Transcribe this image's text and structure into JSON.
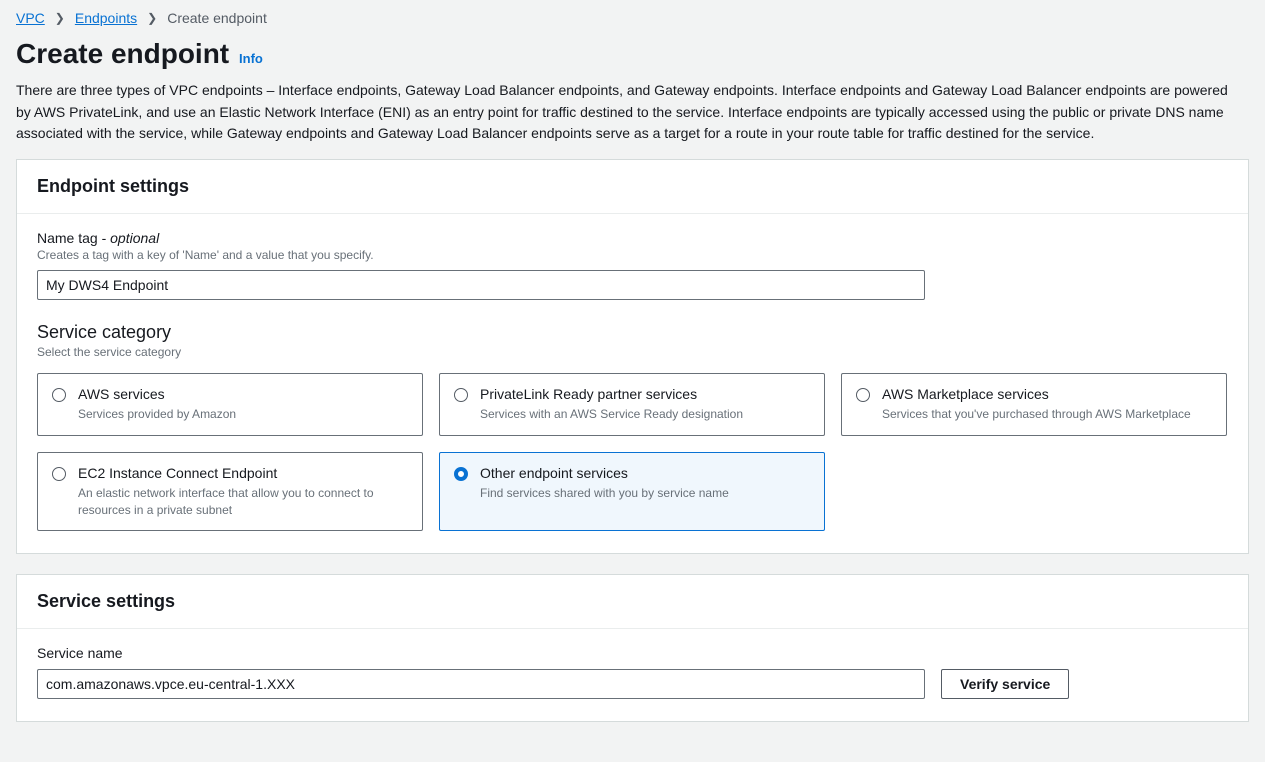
{
  "breadcrumb": {
    "items": [
      {
        "label": "VPC",
        "link": true
      },
      {
        "label": "Endpoints",
        "link": true
      },
      {
        "label": "Create endpoint",
        "link": false
      }
    ]
  },
  "page": {
    "title": "Create endpoint",
    "info_label": "Info",
    "intro": "There are three types of VPC endpoints – Interface endpoints, Gateway Load Balancer endpoints, and Gateway endpoints. Interface endpoints and Gateway Load Balancer endpoints are powered by AWS PrivateLink, and use an Elastic Network Interface (ENI) as an entry point for traffic destined to the service. Interface endpoints are typically accessed using the public or private DNS name associated with the service, while Gateway endpoints and Gateway Load Balancer endpoints serve as a target for a route in your route table for traffic destined for the service."
  },
  "endpoint_settings": {
    "panel_title": "Endpoint settings",
    "name_tag": {
      "label": "Name tag - ",
      "optional": "optional",
      "description": "Creates a tag with a key of 'Name' and a value that you specify.",
      "value": "My DWS4 Endpoint"
    },
    "service_category": {
      "label": "Service category",
      "description": "Select the service category",
      "options": [
        {
          "title": "AWS services",
          "description": "Services provided by Amazon",
          "selected": false
        },
        {
          "title": "PrivateLink Ready partner services",
          "description": "Services with an AWS Service Ready designation",
          "selected": false
        },
        {
          "title": "AWS Marketplace services",
          "description": "Services that you've purchased through AWS Marketplace",
          "selected": false
        },
        {
          "title": "EC2 Instance Connect Endpoint",
          "description": "An elastic network interface that allow you to connect to resources in a private subnet",
          "selected": false
        },
        {
          "title": "Other endpoint services",
          "description": "Find services shared with you by service name",
          "selected": true
        }
      ]
    }
  },
  "service_settings": {
    "panel_title": "Service settings",
    "service_name": {
      "label": "Service name",
      "value": "com.amazonaws.vpce.eu-central-1.XXX"
    },
    "verify_button": "Verify service"
  }
}
